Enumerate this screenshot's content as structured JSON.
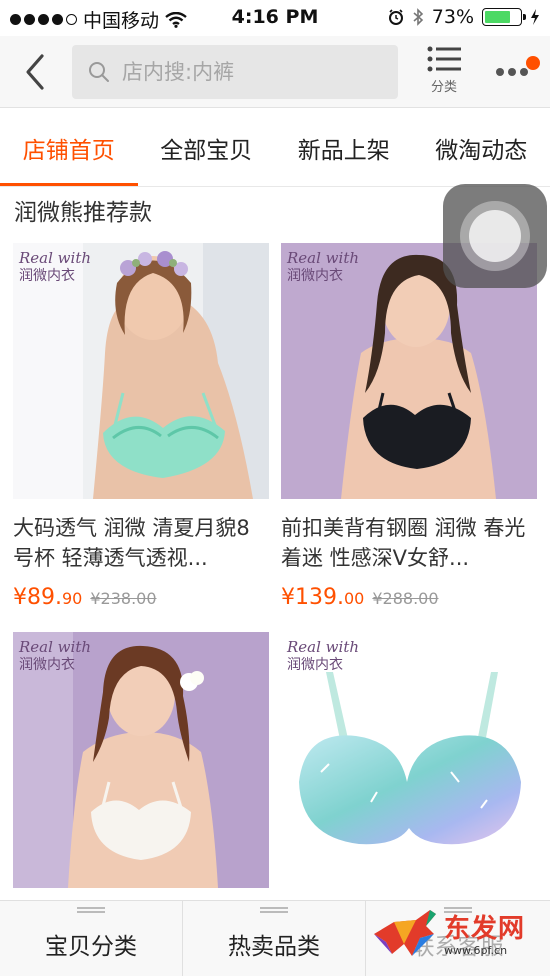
{
  "status_bar": {
    "carrier": "中国移动",
    "time": "4:16 PM",
    "battery_percent": "73%",
    "battery_level": 0.73,
    "icons": [
      "signal-dots-icon",
      "wifi-icon",
      "alarm-icon",
      "bluetooth-icon",
      "battery-icon",
      "charging-icon"
    ]
  },
  "nav": {
    "search_placeholder": "店内搜:内裤",
    "category_label": "分类",
    "icons": [
      "back-icon",
      "search-icon",
      "list-icon",
      "more-icon"
    ]
  },
  "tabs": [
    {
      "label": "店铺首页",
      "active": true
    },
    {
      "label": "全部宝贝",
      "active": false
    },
    {
      "label": "新品上架",
      "active": false
    },
    {
      "label": "微淘动态",
      "active": false
    }
  ],
  "section": {
    "title": "润微熊推荐款"
  },
  "brand": {
    "en": "Real with",
    "cn": "润微内衣"
  },
  "products": [
    {
      "title": "大码透气 润微 清夏月貌8号杯 轻薄透气透视...",
      "price_int": "¥89.",
      "price_dec": "90",
      "old_price": "¥238.00",
      "image": "mint-lace-bra-photo"
    },
    {
      "title": "前扣美背有钢圈 润微 春光着迷 性感深V女舒...",
      "price_int": "¥139.",
      "price_dec": "00",
      "old_price": "¥288.00",
      "image": "black-bra-photo"
    },
    {
      "title": "",
      "price_int": "",
      "price_dec": "",
      "old_price": "",
      "image": "white-lace-bra-photo"
    },
    {
      "title": "",
      "price_int": "",
      "price_dec": "",
      "old_price": "",
      "image": "watercolor-bra-photo"
    }
  ],
  "bottom_bar": {
    "items": [
      {
        "label": "宝贝分类"
      },
      {
        "label": "热卖品类"
      },
      {
        "label": "联系客服"
      }
    ]
  },
  "watermark": {
    "text": "东发网",
    "url": "www.6pf.cn"
  },
  "colors": {
    "accent": "#ff5000",
    "nav_bg": "#f7f7f7",
    "search_bg": "#e6e6e6"
  }
}
